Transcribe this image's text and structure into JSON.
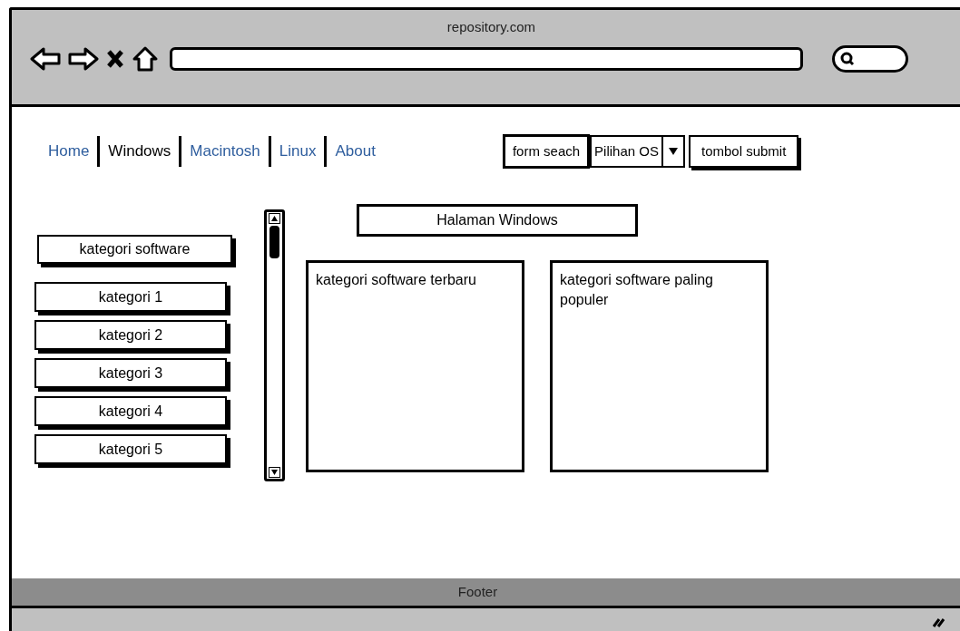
{
  "window": {
    "title": "repository.com"
  },
  "nav": [
    {
      "label": "Home",
      "selected": false
    },
    {
      "label": "Windows",
      "selected": true
    },
    {
      "label": "Macintosh",
      "selected": false
    },
    {
      "label": "Linux",
      "selected": false
    },
    {
      "label": "About",
      "selected": false
    }
  ],
  "search": {
    "field": "form seach",
    "os_select": "Pilihan OS",
    "submit": "tombol submit"
  },
  "sidebar": {
    "title": "kategori software",
    "items": [
      "kategori 1",
      "kategori 2",
      "kategori 3",
      "kategori 4",
      "kategori 5"
    ]
  },
  "page_title": "Halaman Windows",
  "panels": [
    "kategori software terbaru",
    "kategori software paling populer"
  ],
  "footer": "Footer"
}
